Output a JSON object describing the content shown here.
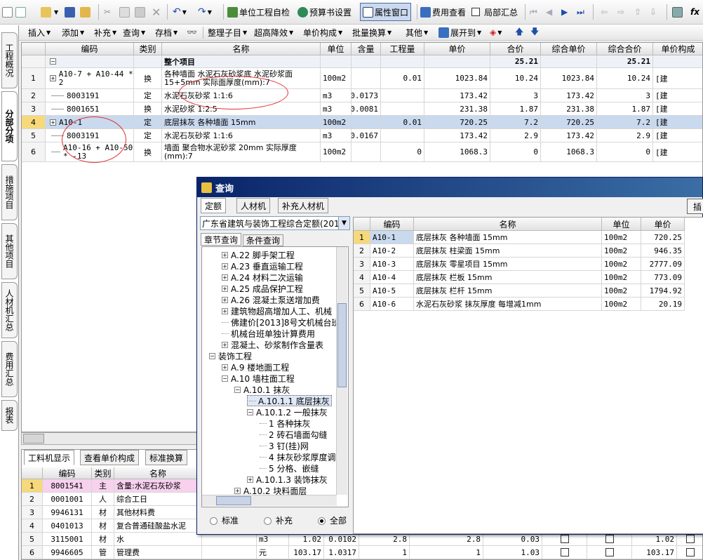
{
  "toolbar1": {
    "unit_check": "单位工程自检",
    "budget_settings": "预算书设置",
    "property_window": "属性窗口",
    "fee_view": "费用查看",
    "local_summary": "局部汇总",
    "fx": "fx"
  },
  "toolbar2": {
    "insert": "插入",
    "add": "添加",
    "supplement": "补充",
    "query": "查询",
    "store": "存档",
    "organize": "整理子目",
    "super_height": "超高降效",
    "unit_price_comp": "单价构成",
    "batch_convert": "批量换算",
    "other": "其他",
    "expand_to": "展开到"
  },
  "side_tabs": [
    "工程概况",
    "分部分项",
    "措施项目",
    "其他项目",
    "人材机汇总",
    "费用汇总",
    "报表"
  ],
  "main_grid": {
    "headers": [
      "编码",
      "类别",
      "名称",
      "单位",
      "含量",
      "工程量",
      "单价",
      "合价",
      "综合单价",
      "综合合价",
      "单价构成"
    ],
    "summary_row": {
      "name": "整个项目",
      "total": "25.21",
      "comp_total": "25.21"
    },
    "rows": [
      {
        "no": "1",
        "code": "A10-7 + A10-44 * 2",
        "type": "换",
        "name": "各种墙面 水泥石灰砂浆底 水泥砂浆面 15+5mm 实际面厚度(mm):7",
        "unit": "100m2",
        "content": "",
        "qty": "0.01",
        "price": "1023.84",
        "total": "10.24",
        "comp_price": "1023.84",
        "comp_total": "10.24",
        "comp": "[建"
      },
      {
        "no": "2",
        "code": "8003191",
        "type": "定",
        "name": "水泥石灰砂浆 1:1:6",
        "unit": "m3",
        "content": "0.0173",
        "qty": "",
        "price": "173.42",
        "total": "3",
        "comp_price": "173.42",
        "comp_total": "3",
        "comp": "[建"
      },
      {
        "no": "3",
        "code": "8001651",
        "type": "换",
        "name": "水泥砂浆 1:2.5",
        "unit": "m3",
        "content": "0.0081",
        "qty": "",
        "price": "231.38",
        "total": "1.87",
        "comp_price": "231.38",
        "comp_total": "1.87",
        "comp": "[建"
      },
      {
        "no": "4",
        "code": "A10-1",
        "type": "定",
        "name": "底层抹灰 各种墙面 15mm",
        "unit": "100m2",
        "content": "",
        "qty": "0.01",
        "price": "720.25",
        "total": "7.2",
        "comp_price": "720.25",
        "comp_total": "7.2",
        "comp": "[建"
      },
      {
        "no": "5",
        "code": "8003191",
        "type": "定",
        "name": "水泥石灰砂浆 1:1:6",
        "unit": "m3",
        "content": "0.0167",
        "qty": "",
        "price": "173.42",
        "total": "2.9",
        "comp_price": "173.42",
        "comp_total": "2.9",
        "comp": "[建"
      },
      {
        "no": "6",
        "code": "A10-16 + A10-50 * -13",
        "type": "换",
        "name": "墙面 聚合物水泥砂浆 20mm 实际厚度(mm):7",
        "unit": "100m2",
        "content": "",
        "qty": "0",
        "price": "1068.3",
        "total": "0",
        "comp_price": "1068.3",
        "comp_total": "0",
        "comp": "[建"
      }
    ]
  },
  "bottom_panel": {
    "tabs": [
      "工料机显示",
      "查看单价构成",
      "标准换算"
    ],
    "headers": [
      "编码",
      "类别",
      "名称"
    ],
    "rows": [
      {
        "no": "1",
        "code": "8001541",
        "type": "主",
        "name": "含量:水泥石灰砂浆",
        "unit": "",
        "a": "",
        "b": "",
        "c": "",
        "d": "",
        "e": "",
        "f": ""
      },
      {
        "no": "2",
        "code": "0001001",
        "type": "人",
        "name": "综合工日",
        "unit": "",
        "a": "",
        "b": "",
        "c": "",
        "d": "",
        "e": "",
        "f": ""
      },
      {
        "no": "3",
        "code": "9946131",
        "type": "材",
        "name": "其他材料费",
        "unit": "",
        "a": "",
        "b": "",
        "c": "",
        "d": "",
        "e": "",
        "f": ""
      },
      {
        "no": "4",
        "code": "0401013",
        "type": "材",
        "name": "复合普通硅酸盐水泥",
        "unit": "",
        "a": "",
        "b": "",
        "c": "",
        "d": "",
        "e": "",
        "f": ""
      },
      {
        "no": "5",
        "code": "3115001",
        "type": "材",
        "name": "水",
        "unit": "m3",
        "a": "1.02",
        "b": "0.0102",
        "c": "2.8",
        "d": "2.8",
        "e": "0.03",
        "f": "1.02"
      },
      {
        "no": "6",
        "code": "9946605",
        "type": "管",
        "name": "管理费",
        "unit": "元",
        "a": "103.17",
        "b": "1.0317",
        "c": "1",
        "d": "1",
        "e": "1.03",
        "f": "103.17"
      }
    ]
  },
  "dialog": {
    "title": "查询",
    "tabs": [
      "定额",
      "人材机",
      "补充人材机"
    ],
    "quota_select": "广东省建筑与装饰工程综合定额(201",
    "subtabs": [
      "章节查询",
      "条件查询"
    ],
    "tree": [
      {
        "t": "A.22 脚手架工程",
        "lvl": 1,
        "exp": "+"
      },
      {
        "t": "A.23 垂直运输工程",
        "lvl": 1,
        "exp": "+"
      },
      {
        "t": "A.24 材料二次运输",
        "lvl": 1,
        "exp": "+"
      },
      {
        "t": "A.25 成品保护工程",
        "lvl": 1,
        "exp": "+"
      },
      {
        "t": "A.26 混凝土泵送增加费",
        "lvl": 1,
        "exp": "+"
      },
      {
        "t": "建筑物超高增加人工、机械",
        "lvl": 1,
        "exp": "+"
      },
      {
        "t": "佛建价[2013]8号文机械台班",
        "lvl": 1,
        "exp": ""
      },
      {
        "t": "机械台班单独计算费用",
        "lvl": 1,
        "exp": ""
      },
      {
        "t": "混凝土、砂浆制作含量表",
        "lvl": 1,
        "exp": "+"
      },
      {
        "t": "装饰工程",
        "lvl": 0,
        "exp": "-"
      },
      {
        "t": "A.9 楼地面工程",
        "lvl": 1,
        "exp": "+"
      },
      {
        "t": "A.10 墙柱面工程",
        "lvl": 1,
        "exp": "-"
      },
      {
        "t": "A.10.1 抹灰",
        "lvl": 2,
        "exp": "-"
      },
      {
        "t": "A.10.1.1 底层抹灰",
        "lvl": 3,
        "exp": "",
        "sel": true
      },
      {
        "t": "A.10.1.2 一般抹灰",
        "lvl": 3,
        "exp": "-"
      },
      {
        "t": "1 各种抹灰",
        "lvl": 4,
        "exp": ""
      },
      {
        "t": "2 砖石墙面勾缝",
        "lvl": 4,
        "exp": ""
      },
      {
        "t": "3 钉(挂)网",
        "lvl": 4,
        "exp": ""
      },
      {
        "t": "4 抹灰砂浆厚度调整",
        "lvl": 4,
        "exp": ""
      },
      {
        "t": "5 分格、嵌缝",
        "lvl": 4,
        "exp": ""
      },
      {
        "t": "A.10.1.3 装饰抹灰",
        "lvl": 3,
        "exp": "+"
      },
      {
        "t": "A.10.2 块料面层",
        "lvl": 2,
        "exp": "+"
      }
    ],
    "radios": [
      "标准",
      "补充",
      "全部"
    ],
    "result_headers": [
      "编码",
      "名称",
      "单位",
      "单价"
    ],
    "results": [
      {
        "no": "1",
        "code": "A10-1",
        "name": "底层抹灰 各种墙面 15mm",
        "unit": "100m2",
        "price": "720.25"
      },
      {
        "no": "2",
        "code": "A10-2",
        "name": "底层抹灰 柱梁面 15mm",
        "unit": "100m2",
        "price": "946.35"
      },
      {
        "no": "3",
        "code": "A10-3",
        "name": "底层抹灰 零星项目 15mm",
        "unit": "100m2",
        "price": "2777.09"
      },
      {
        "no": "4",
        "code": "A10-4",
        "name": "底层抹灰 栏板 15mm",
        "unit": "100m2",
        "price": "773.09"
      },
      {
        "no": "5",
        "code": "A10-5",
        "name": "底层抹灰 栏杆 15mm",
        "unit": "100m2",
        "price": "1794.92"
      },
      {
        "no": "6",
        "code": "A10-6",
        "name": "水泥石灰砂浆 抹灰厚度 每增减1mm",
        "unit": "100m2",
        "price": "20.19"
      }
    ],
    "insert_btn": "插"
  },
  "colors": {
    "accent": "#0a246a",
    "selected_row": "#c9d9ee",
    "highlight_pink": "#f7d1ee",
    "annotation": "#e03030"
  }
}
